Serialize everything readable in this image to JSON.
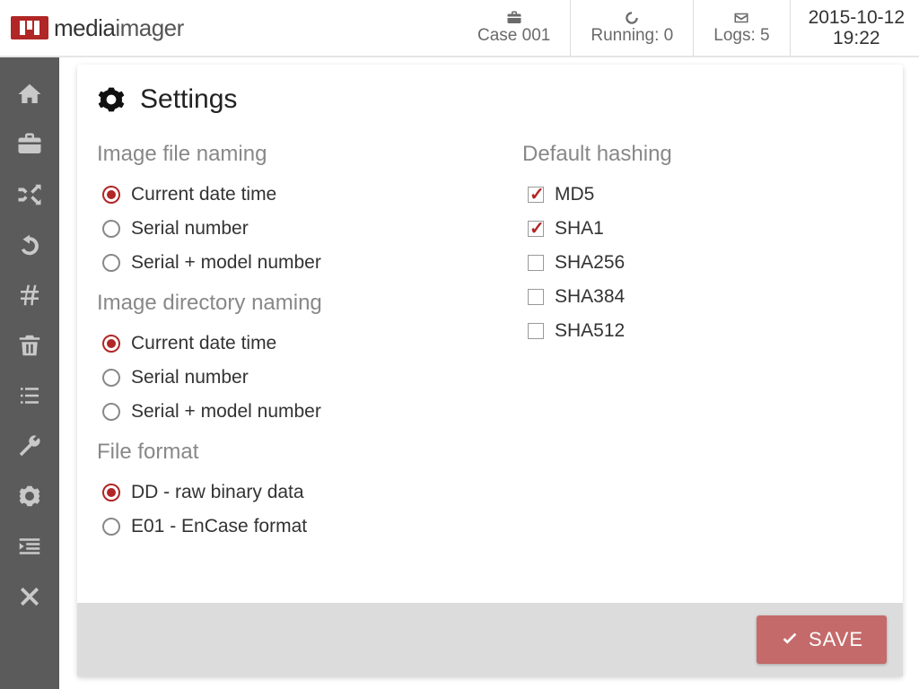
{
  "app": {
    "name_a": "media",
    "name_b": "imager"
  },
  "header": {
    "case_label": "Case 001",
    "running_label": "Running: 0",
    "logs_label": "Logs: 5",
    "date": "2015-10-12",
    "time": "19:22"
  },
  "sidebar": {
    "items": [
      {
        "name": "home-icon"
      },
      {
        "name": "briefcase-icon"
      },
      {
        "name": "shuffle-icon"
      },
      {
        "name": "undo-icon"
      },
      {
        "name": "hash-icon"
      },
      {
        "name": "trash-icon"
      },
      {
        "name": "list-icon"
      },
      {
        "name": "wrench-icon"
      },
      {
        "name": "gear-icon"
      },
      {
        "name": "indent-icon"
      },
      {
        "name": "close-icon"
      }
    ]
  },
  "panel": {
    "title": "Settings",
    "sections": {
      "image_file_naming": {
        "title": "Image file naming",
        "options": [
          {
            "label": "Current date time",
            "checked": true
          },
          {
            "label": "Serial number",
            "checked": false
          },
          {
            "label": "Serial + model number",
            "checked": false
          }
        ]
      },
      "image_dir_naming": {
        "title": "Image directory naming",
        "options": [
          {
            "label": "Current date time",
            "checked": true
          },
          {
            "label": "Serial number",
            "checked": false
          },
          {
            "label": "Serial + model number",
            "checked": false
          }
        ]
      },
      "file_format": {
        "title": "File format",
        "options": [
          {
            "label": "DD - raw binary data",
            "checked": true
          },
          {
            "label": "E01 - EnCase format",
            "checked": false
          }
        ]
      },
      "default_hashing": {
        "title": "Default hashing",
        "options": [
          {
            "label": "MD5",
            "checked": true
          },
          {
            "label": "SHA1",
            "checked": true
          },
          {
            "label": "SHA256",
            "checked": false
          },
          {
            "label": "SHA384",
            "checked": false
          },
          {
            "label": "SHA512",
            "checked": false
          }
        ]
      }
    },
    "save_label": "SAVE"
  },
  "colors": {
    "accent": "#b12626"
  }
}
